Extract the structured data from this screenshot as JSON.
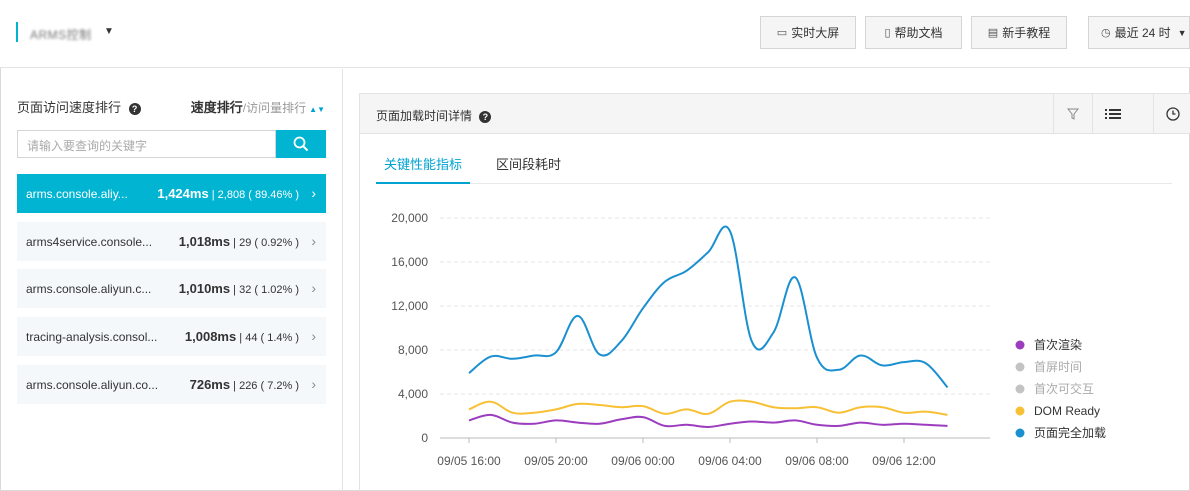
{
  "topbar": {
    "app_name": "ARMS控制",
    "buttons": [
      {
        "label": "实时大屏",
        "icon": "monitor-icon"
      },
      {
        "label": "帮助文档",
        "icon": "document-icon"
      },
      {
        "label": "新手教程",
        "icon": "book-icon"
      }
    ],
    "time_range": {
      "label": "最近 24 时",
      "icon": "clock-icon"
    }
  },
  "left_panel": {
    "title": "页面访问速度排行",
    "sort": {
      "active": "速度排行",
      "separator": "/",
      "inactive": "访问量排行"
    },
    "search_placeholder": "请输入要查询的关键字",
    "items": [
      {
        "host": "arms.console.aliy...",
        "ms": "1,424ms",
        "detail": "| 2,808 ( 89.46% )",
        "active": true
      },
      {
        "host": "arms4service.console...",
        "ms": "1,018ms",
        "detail": "| 29 ( 0.92% )",
        "active": false
      },
      {
        "host": "arms.console.aliyun.c...",
        "ms": "1,010ms",
        "detail": "| 32 ( 1.02% )",
        "active": false
      },
      {
        "host": "tracing-analysis.consol...",
        "ms": "1,008ms",
        "detail": "| 44 ( 1.4% )",
        "active": false
      },
      {
        "host": "arms.console.aliyun.co...",
        "ms": "726ms",
        "detail": "| 226 ( 7.2% )",
        "active": false
      }
    ]
  },
  "detail_panel": {
    "title": "页面加载时间详情",
    "tabs": [
      {
        "label": "关键性能指标",
        "active": true
      },
      {
        "label": "区间段耗时",
        "active": false
      }
    ]
  },
  "colors": {
    "accent": "#00b4d2",
    "tab_active": "#00a2d0"
  },
  "chart_data": {
    "type": "line",
    "title": "",
    "xlabel": "",
    "ylabel": "",
    "ylim": [
      0,
      20000
    ],
    "y_ticks": [
      "0",
      "4,000",
      "8,000",
      "12,000",
      "16,000",
      "20,000"
    ],
    "y_tick_values": [
      0,
      4000,
      8000,
      12000,
      16000,
      20000
    ],
    "x_tick_labels": [
      "09/05 16:00",
      "09/05 20:00",
      "09/06 00:00",
      "09/06 04:00",
      "09/06 08:00",
      "09/06 12:00"
    ],
    "x_tick_hours": [
      0,
      4,
      8,
      12,
      16,
      20
    ],
    "grid": true,
    "legend_position": "right",
    "legend": [
      {
        "name": "首次渲染",
        "color": "#9c3dbf",
        "enabled": true
      },
      {
        "name": "首屏时间",
        "color": "#c3c3c3",
        "enabled": false
      },
      {
        "name": "首次可交互",
        "color": "#c3c3c3",
        "enabled": false
      },
      {
        "name": "DOM Ready",
        "color": "#f7c035",
        "enabled": true
      },
      {
        "name": "页面完全加载",
        "color": "#1b90d0",
        "enabled": true
      }
    ],
    "x_hours": [
      0,
      1,
      2,
      3,
      4,
      5,
      6,
      7,
      8,
      9,
      10,
      11,
      12,
      13,
      14,
      15,
      16,
      17,
      18,
      19,
      20,
      21,
      22,
      23
    ],
    "series": [
      {
        "name": "页面完全加载",
        "color": "#1b90d0",
        "values": [
          5900,
          7400,
          7200,
          7500,
          7800,
          11100,
          7600,
          8800,
          11800,
          14200,
          15200,
          16900,
          18800,
          8800,
          9600,
          14600,
          7300,
          6200,
          7500,
          6600,
          6900,
          6800,
          4600
        ]
      },
      {
        "name": "DOM Ready",
        "color": "#f7c035",
        "values": [
          2600,
          3300,
          2300,
          2300,
          2600,
          3100,
          3000,
          2800,
          2900,
          2200,
          2600,
          2200,
          3300,
          3300,
          2800,
          2700,
          2800,
          2300,
          2800,
          2800,
          2300,
          2400,
          2100
        ]
      },
      {
        "name": "首次渲染",
        "color": "#9c3dbf",
        "values": [
          1600,
          2100,
          1400,
          1300,
          1600,
          1400,
          1300,
          1700,
          1900,
          1100,
          1200,
          1000,
          1300,
          1500,
          1400,
          1600,
          1200,
          1100,
          1400,
          1200,
          1300,
          1200,
          1100
        ]
      }
    ]
  }
}
